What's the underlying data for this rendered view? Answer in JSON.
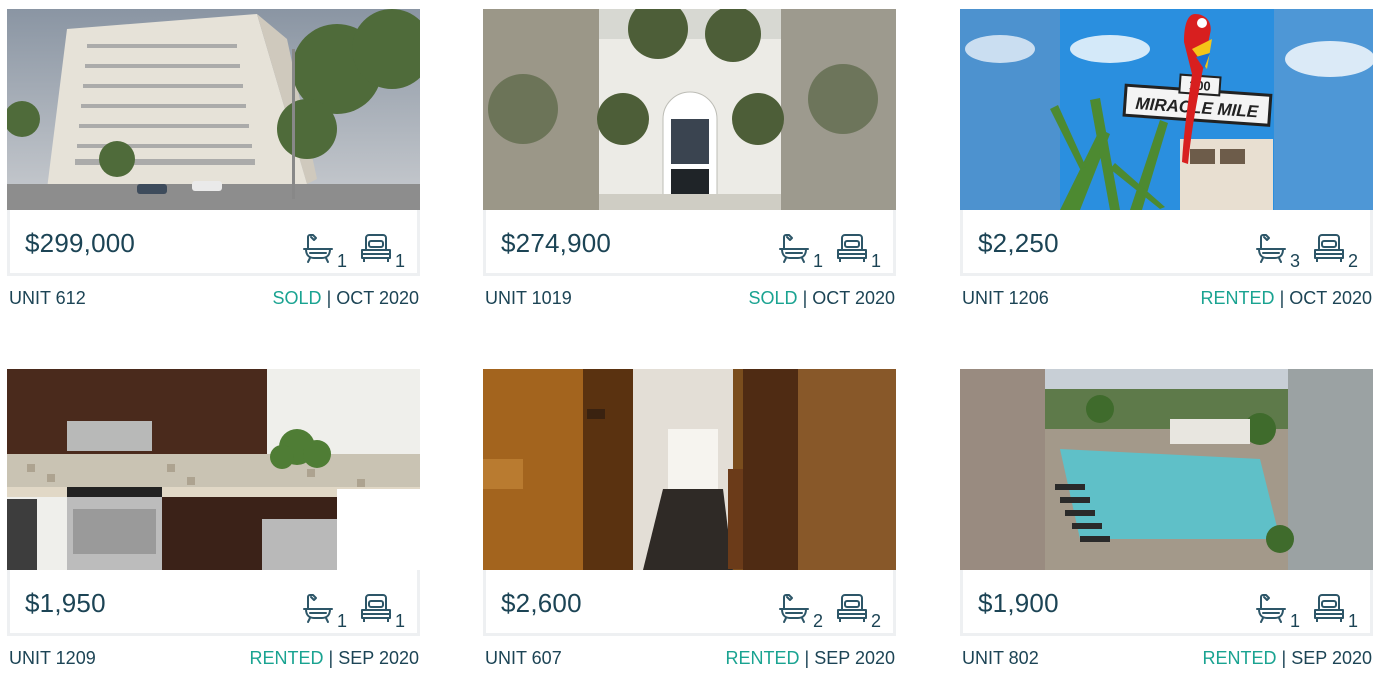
{
  "colors": {
    "text": "#1c4455",
    "status": "#1aa391",
    "border": "#eef0f2",
    "icon": "#2d5668"
  },
  "icons": {
    "bath": "bathtub-icon",
    "bed": "bed-icon"
  },
  "separator": "|",
  "listings": [
    {
      "price": "$299,000",
      "baths": "1",
      "beds": "1",
      "unit": "UNIT 612",
      "status": "SOLD",
      "date": "OCT 2020"
    },
    {
      "price": "$274,900",
      "baths": "1",
      "beds": "1",
      "unit": "UNIT 1019",
      "status": "SOLD",
      "date": "OCT 2020"
    },
    {
      "price": "$2,250",
      "baths": "3",
      "beds": "2",
      "unit": "UNIT 1206",
      "status": "RENTED",
      "date": "OCT 2020",
      "photo_text": [
        "100",
        "MIRACLE MILE"
      ]
    },
    {
      "price": "$1,950",
      "baths": "1",
      "beds": "1",
      "unit": "UNIT 1209",
      "status": "RENTED",
      "date": "SEP 2020"
    },
    {
      "price": "$2,600",
      "baths": "2",
      "beds": "2",
      "unit": "UNIT 607",
      "status": "RENTED",
      "date": "SEP 2020"
    },
    {
      "price": "$1,900",
      "baths": "1",
      "beds": "1",
      "unit": "UNIT 802",
      "status": "RENTED",
      "date": "SEP 2020"
    }
  ]
}
